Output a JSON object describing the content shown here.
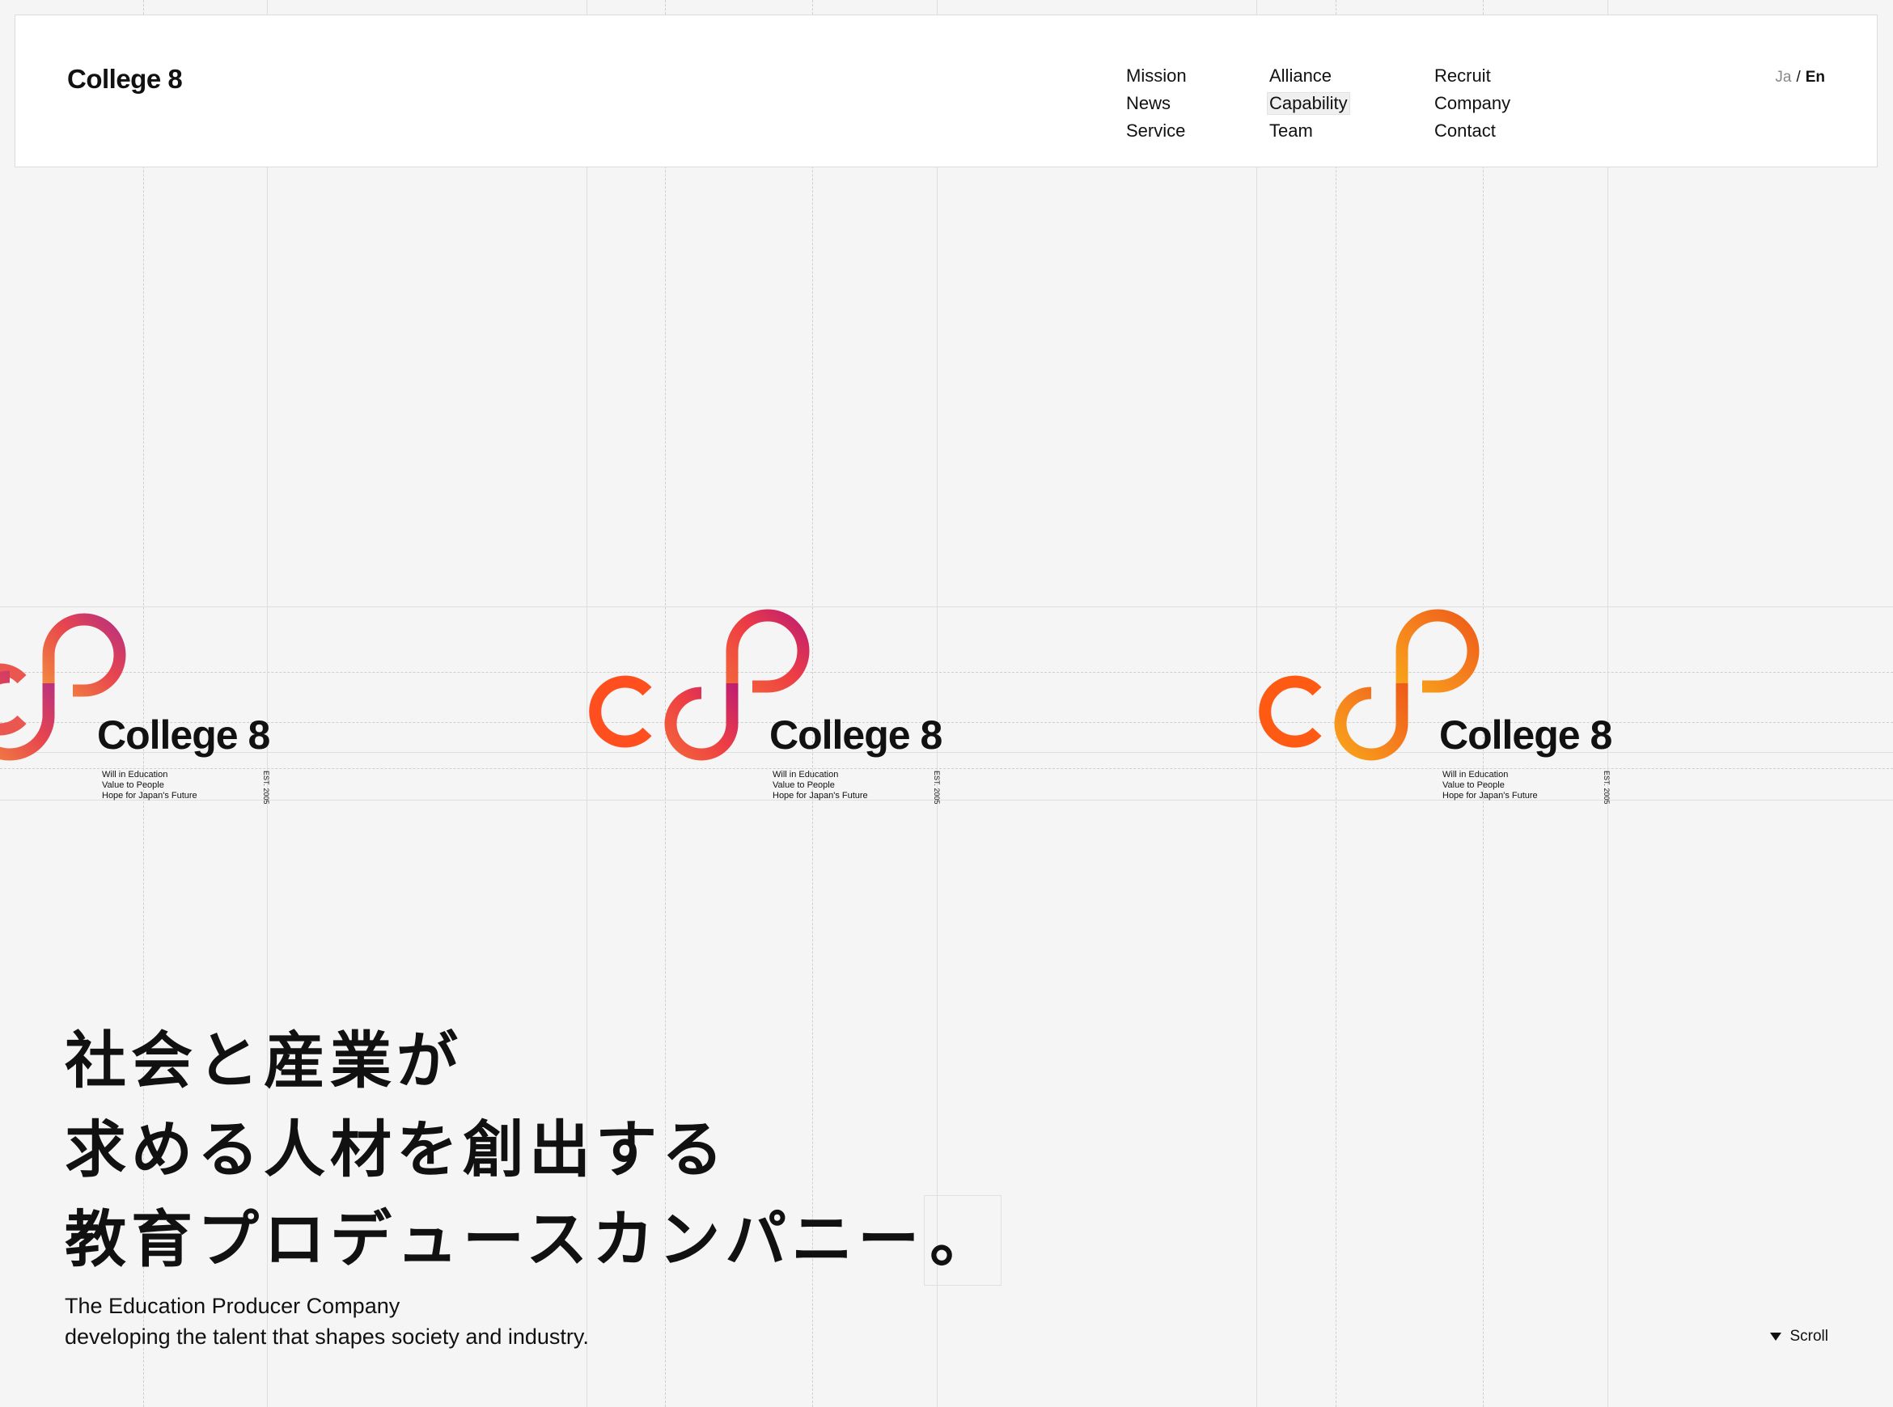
{
  "header": {
    "brand": "College 8",
    "nav_columns": [
      [
        "Mission",
        "News",
        "Service"
      ],
      [
        "Alliance",
        "Capability",
        "Team"
      ],
      [
        "Recruit",
        "Company",
        "Contact"
      ]
    ],
    "lang": {
      "ja": "Ja",
      "separator": "/",
      "en": "En"
    }
  },
  "logos": [
    {
      "wordmark": "College 8",
      "tagline": [
        "Will in Education",
        "Value to People",
        "Hope for Japan's Future"
      ],
      "est": "EST. 2005"
    },
    {
      "wordmark": "College 8",
      "tagline": [
        "Will in Education",
        "Value to People",
        "Hope for Japan's Future"
      ],
      "est": "EST. 2005"
    },
    {
      "wordmark": "College 8",
      "tagline": [
        "Will in Education",
        "Value to People",
        "Hope for Japan's Future"
      ],
      "est": "EST. 2005"
    }
  ],
  "hero": {
    "lines": [
      "社会と産業が",
      "求める人材を創出する",
      "教育プロデュースカンパニー"
    ],
    "last_suffix": "。"
  },
  "subtitle": [
    "The Education Producer Company",
    "developing the talent that shapes society and industry."
  ],
  "scroll": {
    "label": "Scroll"
  },
  "colors": {
    "logo_1_gradient": [
      "#f28a3d",
      "#e8464e",
      "#c2297a"
    ],
    "logo_2_gradient": [
      "#ff4f1f",
      "#f0423f",
      "#c4206e"
    ],
    "logo_3_gradient": [
      "#ff5a14",
      "#f68b1f",
      "#f49b1a"
    ]
  }
}
